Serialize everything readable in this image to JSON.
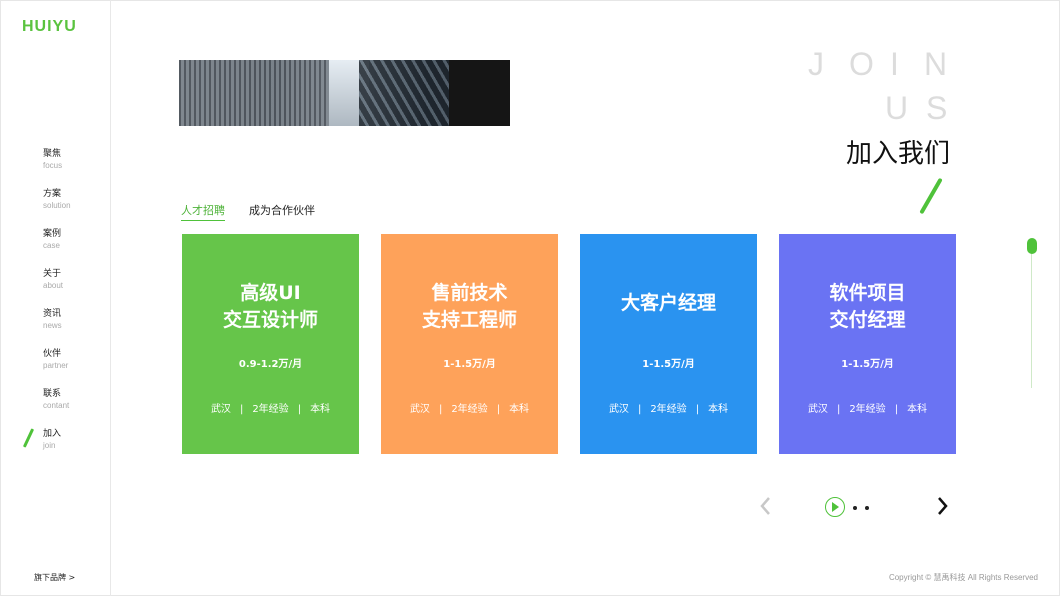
{
  "logo": "HUIYU",
  "sidebar": {
    "items": [
      {
        "zh": "聚焦",
        "en": "focus"
      },
      {
        "zh": "方案",
        "en": "solution"
      },
      {
        "zh": "案例",
        "en": "case"
      },
      {
        "zh": "关于",
        "en": "about"
      },
      {
        "zh": "资讯",
        "en": "news"
      },
      {
        "zh": "伙伴",
        "en": "partner"
      },
      {
        "zh": "联系",
        "en": "contant"
      },
      {
        "zh": "加入",
        "en": "join"
      }
    ],
    "active_index": 7,
    "brand_link": "旗下品牌  >"
  },
  "header": {
    "join_letters": [
      "J",
      "O",
      "I",
      "N"
    ],
    "us_letters": [
      "U",
      "S"
    ],
    "title": "加入我们"
  },
  "tabs": [
    {
      "label": "人才招聘",
      "active": true
    },
    {
      "label": "成为合作伙伴",
      "active": false
    }
  ],
  "cards": [
    {
      "title_line1": "高级UI",
      "title_line2": "交互设计师",
      "salary": "0.9-1.2万/月",
      "city": "武汉",
      "exp": "2年经验",
      "edu": "本科",
      "color": "#66c54a"
    },
    {
      "title_line1": "售前技术",
      "title_line2": "支持工程师",
      "salary": "1-1.5万/月",
      "city": "武汉",
      "exp": "2年经验",
      "edu": "本科",
      "color": "#fea25a"
    },
    {
      "title_line1": "大客户经理",
      "title_line2": "",
      "salary": "1-1.5万/月",
      "city": "武汉",
      "exp": "2年经验",
      "edu": "本科",
      "color": "#2a93f0"
    },
    {
      "title_line1": "软件项目",
      "title_line2": "交付经理",
      "salary": "1-1.5万/月",
      "city": "武汉",
      "exp": "2年经验",
      "edu": "本科",
      "color": "#6a73f3"
    }
  ],
  "meta_separator": "|",
  "pager": {
    "dots": 3,
    "active_dot": 0
  },
  "accent_color": "#4fc23a",
  "copyright": "Copyright © 慧禹科技 All Rights Reserved"
}
